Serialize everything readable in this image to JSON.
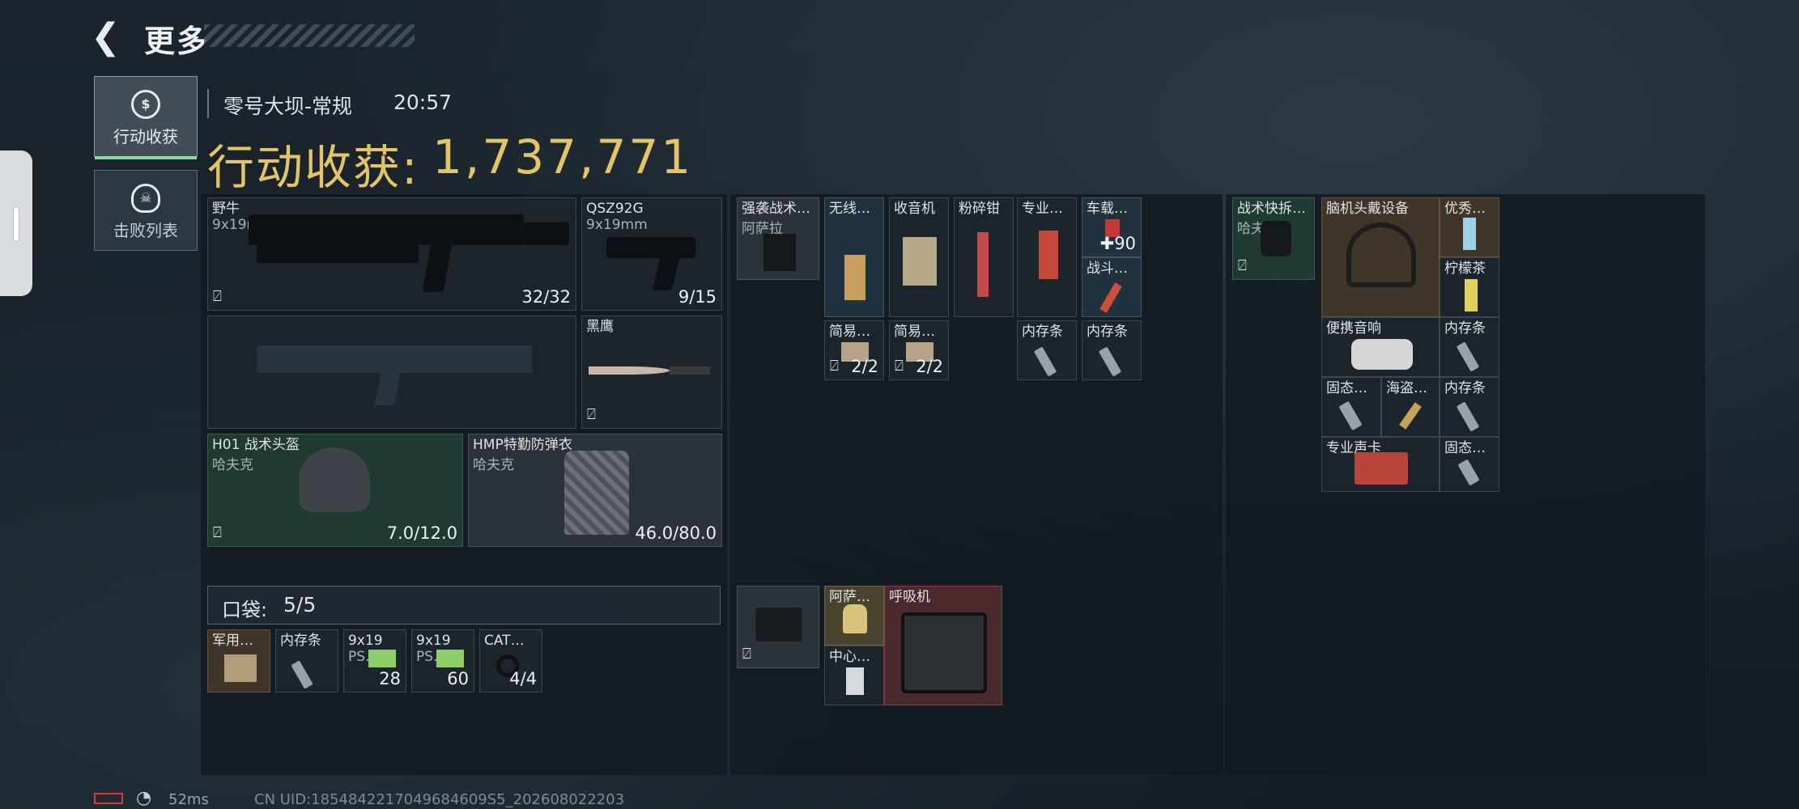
{
  "header": {
    "back_icon": "chevron-left-icon",
    "title": "更多"
  },
  "tabs": [
    {
      "label": "行动收获",
      "icon": "loot-coin-icon",
      "active": true
    },
    {
      "label": "击败列表",
      "icon": "skull-icon",
      "active": false
    }
  ],
  "match": {
    "map": "零号大坝-常规",
    "time": "20:57"
  },
  "loot": {
    "label": "行动收获:",
    "value": "1,737,771",
    "color": "#e4c566"
  },
  "equipment": {
    "primary": {
      "name": "野牛",
      "ammo_type": "9x19mm",
      "ammo": "32/32"
    },
    "sidearm": {
      "name": "QSZ92G",
      "ammo_type": "9x19mm",
      "ammo": "9/15"
    },
    "melee": {
      "name": "黑鹰"
    },
    "helmet": {
      "name": "H01 战术头盔",
      "brand": "哈夫克",
      "durability": "7.0/12.0"
    },
    "armor": {
      "name": "HMP特勤防弹衣",
      "brand": "哈夫克",
      "durability": "46.0/80.0"
    }
  },
  "pocket": {
    "label": "口袋:",
    "value": "5/5",
    "items": [
      {
        "name": "军用…"
      },
      {
        "name": "内存条"
      },
      {
        "name": "9x19",
        "sub": "PS…",
        "count": "28"
      },
      {
        "name": "9x19",
        "sub": "PS…",
        "count": "60"
      },
      {
        "name": "CAT…",
        "count": "4/4"
      }
    ]
  },
  "chest_rig": {
    "rig": {
      "name": "强袭战术…",
      "brand": "阿萨拉"
    },
    "items": [
      {
        "name": "无线…"
      },
      {
        "name": "收音机"
      },
      {
        "name": "粉碎钳"
      },
      {
        "name": "专业…"
      },
      {
        "name": "车载…",
        "count": "90"
      },
      {
        "name": "战斗…"
      },
      {
        "name": "简易…",
        "count": "2/2"
      },
      {
        "name": "简易…",
        "count": "2/2"
      },
      {
        "name": "内存条"
      },
      {
        "name": "内存条"
      }
    ]
  },
  "case": {
    "items": [
      {
        "name": "阿萨…"
      },
      {
        "name": "中心…"
      },
      {
        "name": "呼吸机"
      }
    ]
  },
  "backpack": {
    "bag": {
      "name": "战术快拆…",
      "brand": "哈夫克"
    },
    "items": [
      {
        "name": "脑机头戴设备"
      },
      {
        "name": "优秀…"
      },
      {
        "name": "柠檬茶"
      },
      {
        "name": "便携音响"
      },
      {
        "name": "内存条"
      },
      {
        "name": "固态…"
      },
      {
        "name": "海盗…"
      },
      {
        "name": "内存条"
      },
      {
        "name": "专业声卡"
      },
      {
        "name": "固态…"
      }
    ]
  },
  "status_bar": {
    "ping": "52ms",
    "uid": "CN UID:1854842217049684609S5_202608022203"
  },
  "icons": {
    "lock": "no-insurance-icon",
    "wifi": "wifi-icon",
    "battery": "battery-low-icon"
  }
}
